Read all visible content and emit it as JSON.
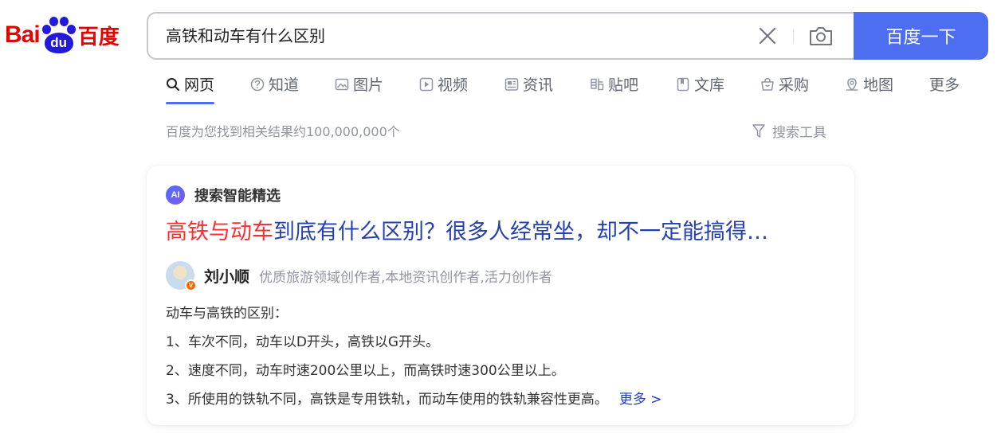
{
  "logo": {
    "latin": "Bai",
    "paw": "du",
    "chinese": "百度"
  },
  "search": {
    "query": "高铁和动车有什么区别",
    "clear_icon": "close-icon",
    "camera_icon": "camera-icon",
    "button_label": "百度一下"
  },
  "tabs": [
    {
      "label": "网页",
      "icon": "search-icon",
      "active": true
    },
    {
      "label": "知道",
      "icon": "question-icon"
    },
    {
      "label": "图片",
      "icon": "image-icon"
    },
    {
      "label": "视频",
      "icon": "video-icon"
    },
    {
      "label": "资讯",
      "icon": "news-icon"
    },
    {
      "label": "贴吧",
      "icon": "tieba-icon"
    },
    {
      "label": "文库",
      "icon": "doc-icon"
    },
    {
      "label": "采购",
      "icon": "shopping-icon"
    },
    {
      "label": "地图",
      "icon": "map-icon"
    },
    {
      "label": "更多"
    }
  ],
  "stats": {
    "text": "百度为您找到相关结果约100,000,000个",
    "tools_label": "搜索工具"
  },
  "card": {
    "ai_badge": "AI",
    "ai_label": "搜索智能精选",
    "title_highlight": "高铁与动车",
    "title_rest": "到底有什么区别？很多人经常坐，却不一定能搞得…",
    "author_name": "刘小顺",
    "author_badge": "V",
    "author_desc": "优质旅游领域创作者,本地资讯创作者,活力创作者",
    "lines": [
      "动车与高铁的区别：",
      "1、车次不同，动车以D开头，高铁以G开头。",
      "2、速度不同，动车时速200公里以上，而高铁时速300公里以上。",
      "3、所使用的铁轨不同，高铁是专用铁轨，而动车使用的铁轨兼容性更高。"
    ],
    "more_label": "更多 >"
  }
}
